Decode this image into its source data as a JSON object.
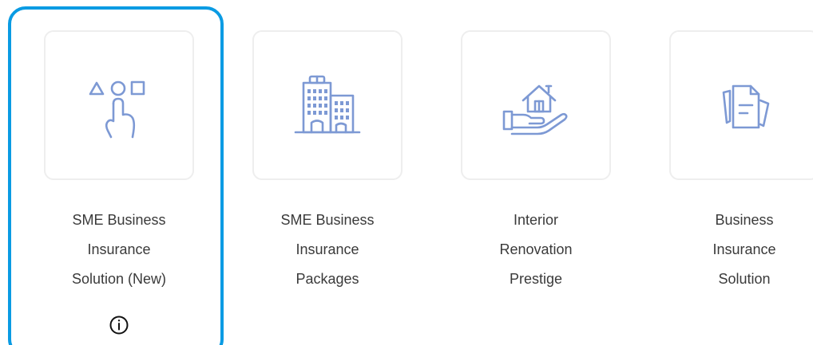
{
  "products": [
    {
      "label": "SME Business\nInsurance\nSolution (New)",
      "icon": "shapes-pointer-icon",
      "selected": true,
      "has_info": true
    },
    {
      "label": "SME Business\nInsurance\nPackages",
      "icon": "building-icon",
      "selected": false,
      "has_info": false
    },
    {
      "label": "Interior\nRenovation\nPrestige",
      "icon": "house-in-hand-icon",
      "selected": false,
      "has_info": false
    },
    {
      "label": "Business\nInsurance\nSolution",
      "icon": "documents-icon",
      "selected": false,
      "has_info": false
    }
  ],
  "colors": {
    "selection_border": "#0a9be3",
    "icon_stroke": "#7d99d4",
    "tile_border": "#eeeeee",
    "label_text": "#3a3a3a"
  }
}
